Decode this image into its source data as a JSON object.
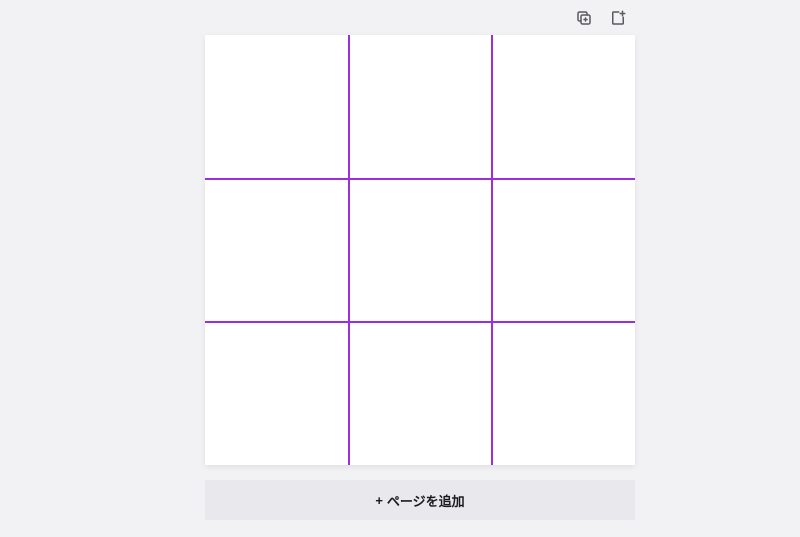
{
  "toolbar": {
    "duplicate_icon": "duplicate-icon",
    "add_icon": "add-page-icon"
  },
  "canvas": {
    "grid_color": "#9b2fd9",
    "grid_divisions": 3
  },
  "footer": {
    "add_page_plus": "+",
    "add_page_label": "ページを追加"
  }
}
